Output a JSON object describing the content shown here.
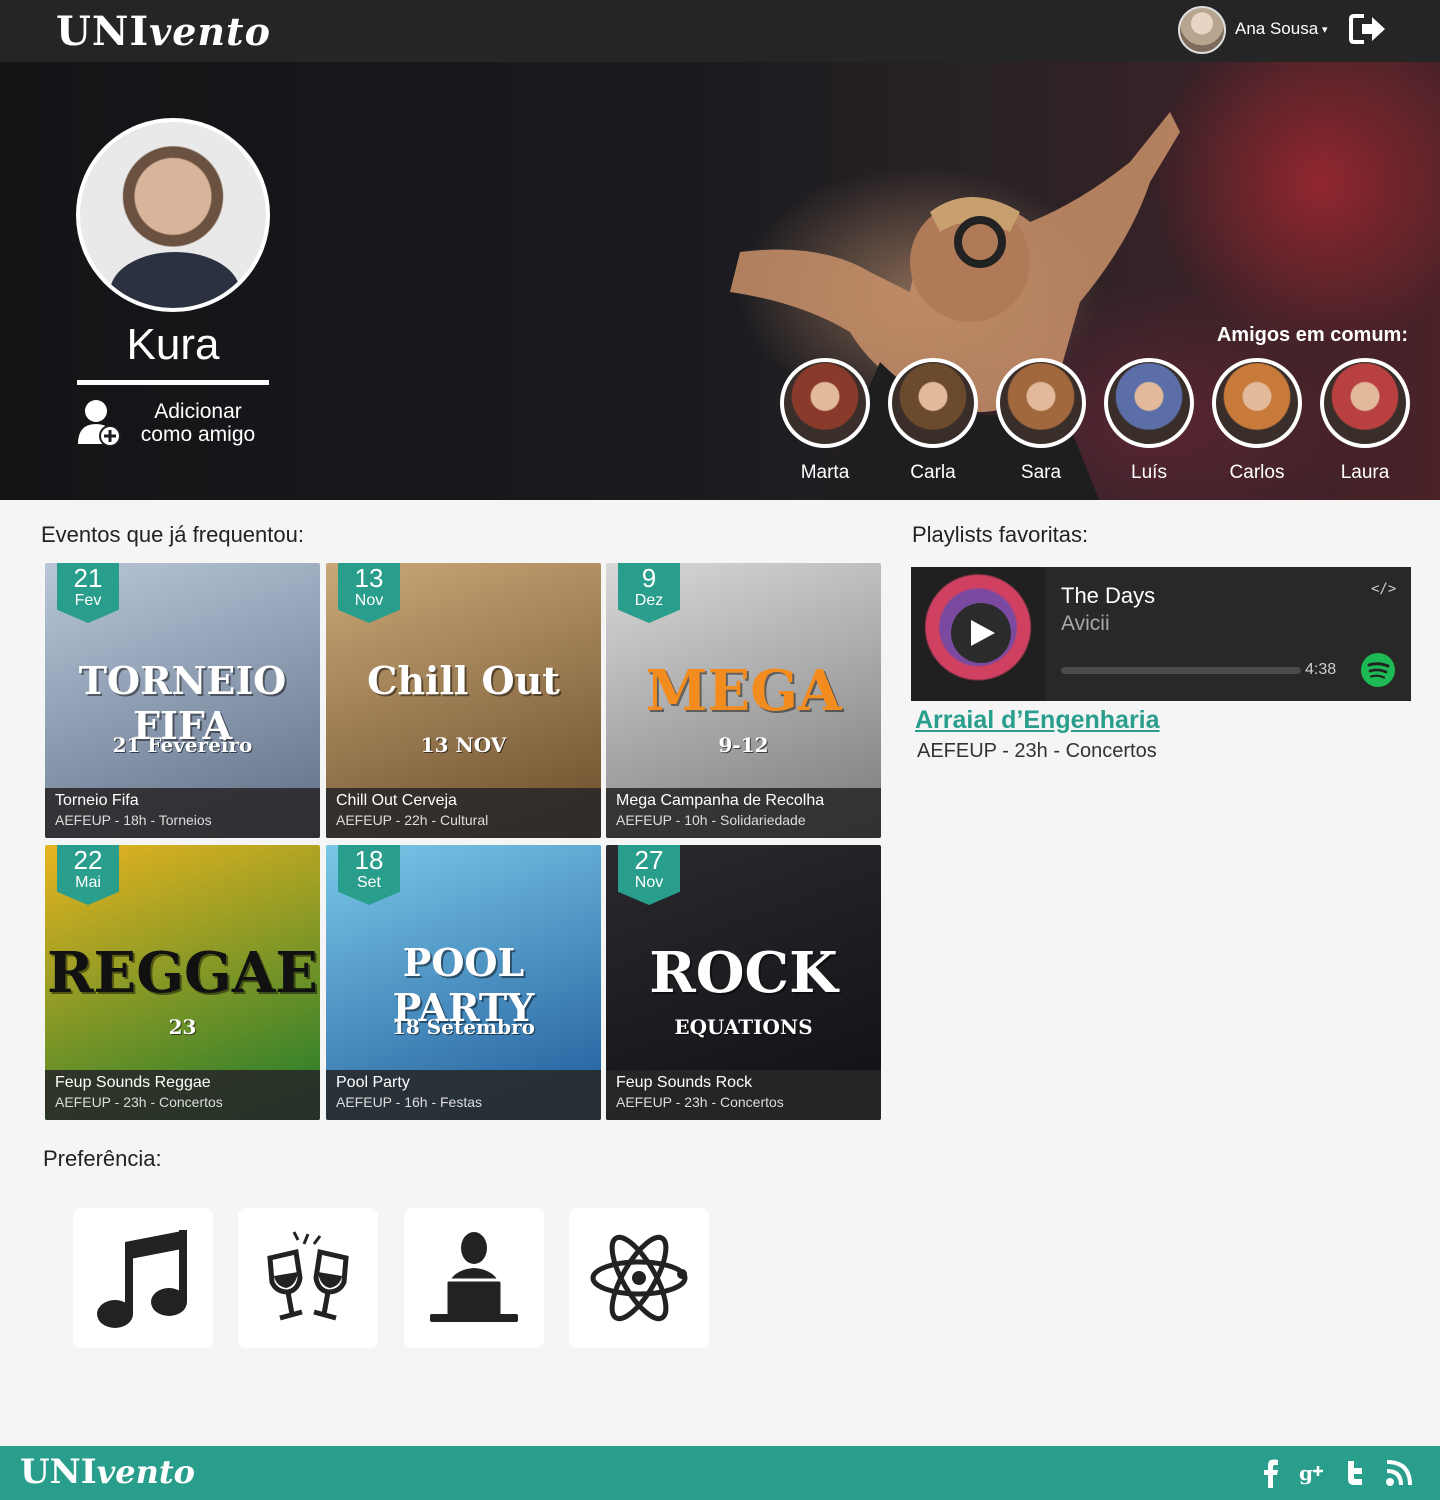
{
  "header": {
    "logo_main": "UNI",
    "logo_script": "vento",
    "user_name": "Ana Sousa",
    "caret": "▾"
  },
  "profile": {
    "name": "Kura",
    "add_friend_label": "Adicionar como amigo"
  },
  "friends": {
    "title": "Amigos em comum:",
    "items": [
      {
        "name": "Marta",
        "color": "#8a3a2a"
      },
      {
        "name": "Carla",
        "color": "#6b4a2e"
      },
      {
        "name": "Sara",
        "color": "#a0683c"
      },
      {
        "name": "Luís",
        "color": "#5c6ea8"
      },
      {
        "name": "Carlos",
        "color": "#c87a3a"
      },
      {
        "name": "Laura",
        "color": "#b84040"
      }
    ]
  },
  "events": {
    "title": "Eventos que já frequentou:",
    "items": [
      {
        "day": "21",
        "month": "Fev",
        "title": "Torneio Fifa",
        "meta": "AEFEUP - 18h - Torneios",
        "poster_text": "TORNEIO FIFA",
        "poster_sub": "21 Fevereiro",
        "colors": [
          "#b8c6d8",
          "#5e6e86"
        ]
      },
      {
        "day": "13",
        "month": "Nov",
        "title": "Chill Out Cerveja",
        "meta": "AEFEUP - 22h - Cultural",
        "poster_text": "Chill Out",
        "poster_sub": "13 NOV",
        "colors": [
          "#c9a877",
          "#6b4c2a"
        ]
      },
      {
        "day": "9",
        "month": "Dez",
        "title": "Mega Campanha de Recolha",
        "meta": "AEFEUP - 10h - Solidariedade",
        "poster_text": "MEGA",
        "poster_sub": "9-12",
        "colors": [
          "#d8d8d8",
          "#7a7a7a"
        ]
      },
      {
        "day": "22",
        "month": "Mai",
        "title": "Feup Sounds Reggae",
        "meta": "AEFEUP - 23h - Concertos",
        "poster_text": "REGGAE",
        "poster_sub": "23",
        "colors": [
          "#e8b420",
          "#1c7a2c"
        ]
      },
      {
        "day": "18",
        "month": "Set",
        "title": "Pool Party",
        "meta": "AEFEUP - 16h - Festas",
        "poster_text": "POOL PARTY",
        "poster_sub": "18 Setembro",
        "colors": [
          "#7ac8e8",
          "#1e5a9a"
        ]
      },
      {
        "day": "27",
        "month": "Nov",
        "title": "Feup Sounds Rock",
        "meta": "AEFEUP - 23h - Concertos",
        "poster_text": "ROCK",
        "poster_sub": "EQUATIONS",
        "colors": [
          "#2a2a2e",
          "#101014"
        ]
      }
    ]
  },
  "playlists": {
    "title": "Playlists favoritas:",
    "song": "The Days",
    "artist": "Avicii",
    "duration": "4:38",
    "progress_fraction": 0.0,
    "embed_label": "</>",
    "link_title": "Arraial d’Engenharia",
    "link_meta": "AEFEUP - 23h - Concertos"
  },
  "preferences": {
    "title": "Preferência:",
    "icons": [
      "music-note-icon",
      "toast-glasses-icon",
      "laptop-user-icon",
      "atom-icon"
    ]
  },
  "footer": {
    "logo_main": "UNI",
    "logo_script": "vento",
    "social": [
      "facebook-icon",
      "google-plus-icon",
      "twitter-icon",
      "rss-icon"
    ]
  },
  "colors": {
    "accent": "#2a9e8c",
    "topbar": "#252525",
    "spotify": "#1db954"
  }
}
